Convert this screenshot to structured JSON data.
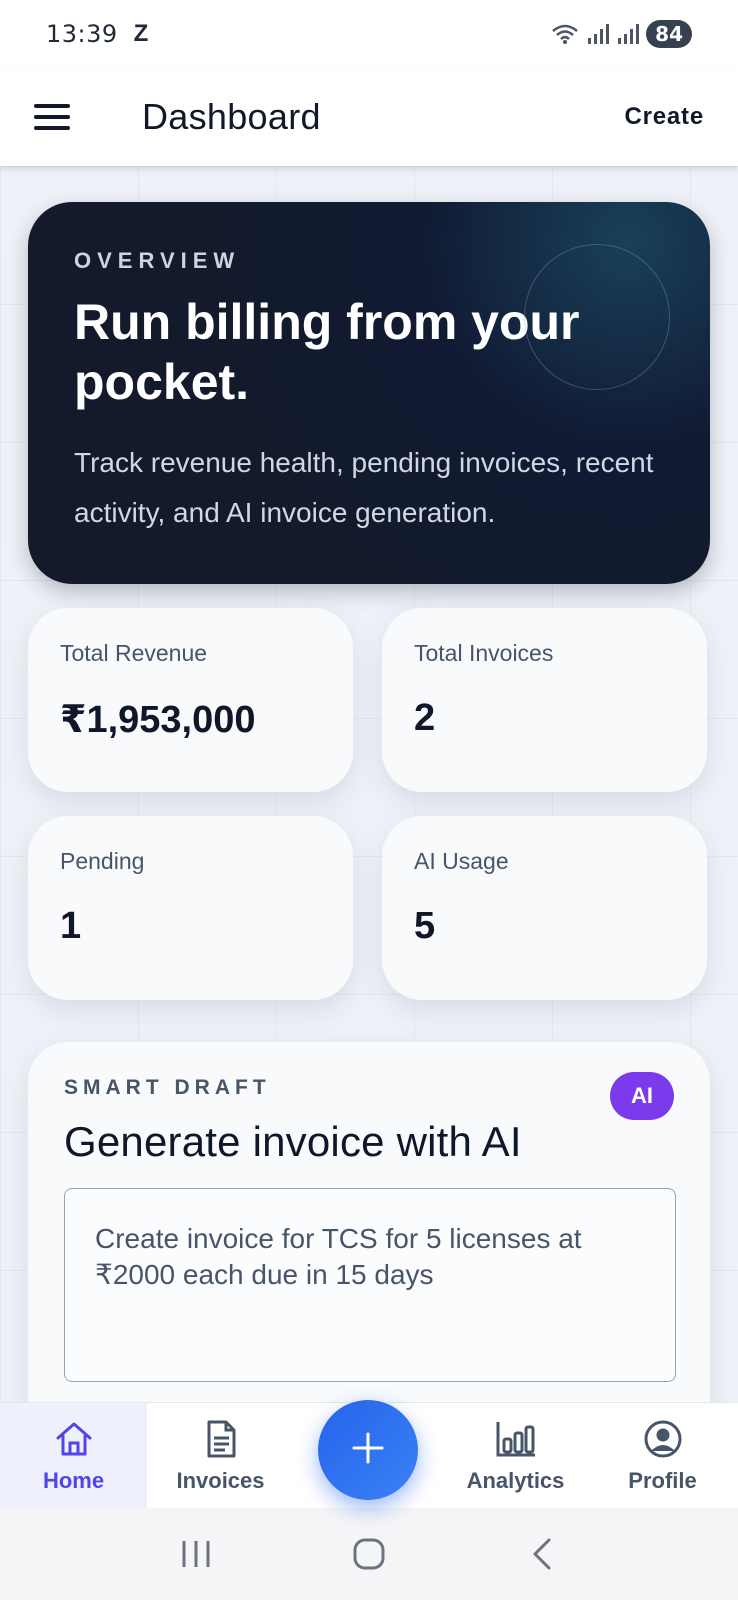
{
  "status_bar": {
    "time": "13:39",
    "carrier_glyph": "Z",
    "battery": "84",
    "icons": [
      "wifi-icon",
      "signal-icon",
      "signal-icon",
      "battery-icon"
    ]
  },
  "app_bar": {
    "title": "Dashboard",
    "create_label": "Create",
    "menu_icon": "menu-icon"
  },
  "hero": {
    "eyebrow": "OVERVIEW",
    "title": "Run billing from your pocket.",
    "subtitle": "Track revenue health, pending invoices, recent activity, and AI invoice generation."
  },
  "stats": [
    {
      "label": "Total Revenue",
      "value": "₹1,953,000"
    },
    {
      "label": "Total Invoices",
      "value": "2"
    },
    {
      "label": "Pending",
      "value": "1"
    },
    {
      "label": "AI Usage",
      "value": "5"
    }
  ],
  "smart_draft": {
    "eyebrow": "SMART DRAFT",
    "title": "Generate invoice with AI",
    "badge": "AI",
    "prompt": "Create invoice for TCS for 5 licenses at ₹2000 each due in 15 days"
  },
  "bottom_nav": {
    "items": [
      {
        "label": "Home",
        "icon": "home-icon",
        "active": true
      },
      {
        "label": "Invoices",
        "icon": "document-icon",
        "active": false
      },
      {
        "label": "Analytics",
        "icon": "bar-chart-icon",
        "active": false
      },
      {
        "label": "Profile",
        "icon": "profile-icon",
        "active": false
      }
    ],
    "fab_icon": "plus-icon"
  },
  "colors": {
    "accent": "#4f46e5",
    "fab": "#2563eb",
    "badge": "#7c3aed",
    "hero_bg": "#141a2a"
  }
}
